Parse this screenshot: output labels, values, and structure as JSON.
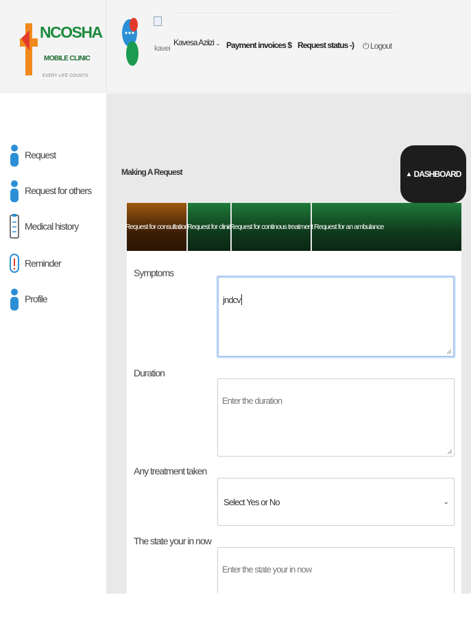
{
  "header": {
    "logo": {
      "name": "NCOSHA",
      "subtitle": "MOBILE CLINIC",
      "tagline": "EVERY LIFE COUNTS"
    },
    "broken_image_alt": "kavei",
    "nav": {
      "user_name": "Kavesa Aziizi",
      "payment_invoices": "Payment invoices $",
      "request_status": "Request status -)",
      "logout": "Logout"
    }
  },
  "sidebar": {
    "items": [
      {
        "label": "Request",
        "icon": "person-icon"
      },
      {
        "label": "Request for others",
        "icon": "person-icon"
      },
      {
        "label": "Medical history",
        "icon": "clipboard-icon"
      },
      {
        "label": "Reminder",
        "icon": "alert-icon"
      },
      {
        "label": "Profile",
        "icon": "person-icon"
      }
    ]
  },
  "main": {
    "title": "Making A Request",
    "dashboard_button": "DASHBOARD",
    "tabs": [
      {
        "label": "Request for consultation",
        "active": true
      },
      {
        "label": "Request for clinic",
        "active": false
      },
      {
        "label": "Request for continous treatment",
        "active": false
      },
      {
        "label": "Request for an ambulance",
        "active": false
      }
    ],
    "form": {
      "symptoms": {
        "label": "Symptoms",
        "value": "jndcv",
        "placeholder": ""
      },
      "duration": {
        "label": "Duration",
        "value": "",
        "placeholder": "Enter the duration"
      },
      "treatment": {
        "label": "Any treatment taken",
        "selected": "Select Yes or No"
      },
      "state": {
        "label": "The state your in now",
        "value": "",
        "placeholder": "Enter the state your in now"
      }
    }
  },
  "colors": {
    "brand_green": "#1c8a3c",
    "brand_orange": "#f08a1c",
    "tab_green": "#0f3a1c",
    "tab_active_brown": "#5a300a",
    "dashboard_bg": "#1d1d1d",
    "sidebar_icon_blue": "#2c8fd6"
  }
}
